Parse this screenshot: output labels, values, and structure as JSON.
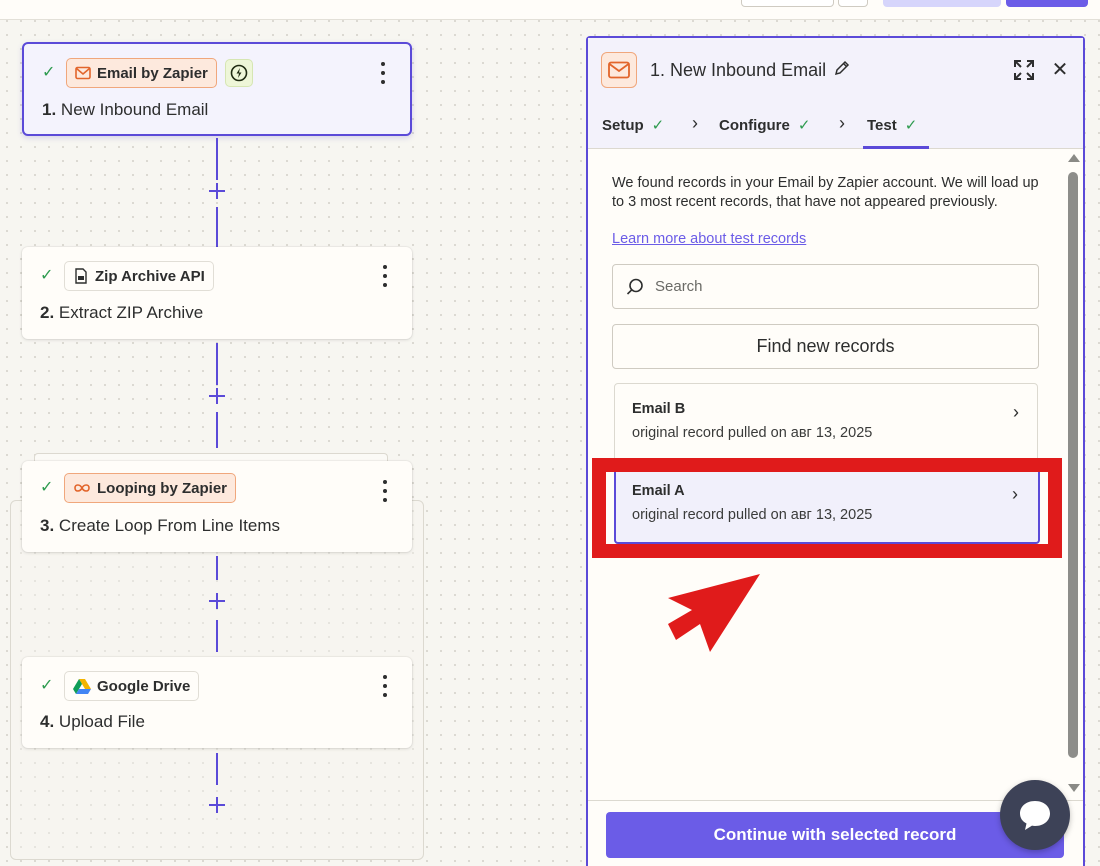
{
  "colors": {
    "accent": "#6b5ce7",
    "border_accent": "#5b4ad8",
    "success": "#2e9b4f",
    "annotation": "#e01b1b",
    "chat": "#3d4257"
  },
  "workflow": {
    "steps": [
      {
        "app": "Email by Zapier",
        "number": "1.",
        "title": "New Inbound Email",
        "icon": "email-icon",
        "status": "check-icon"
      },
      {
        "app": "Zip Archive API",
        "number": "2.",
        "title": "Extract ZIP Archive",
        "icon": "zip-archive-icon",
        "status": "check-icon"
      },
      {
        "app": "Looping by Zapier",
        "number": "3.",
        "title": "Create Loop From Line Items",
        "icon": "loop-icon",
        "status": "check-icon"
      },
      {
        "app": "Google Drive",
        "number": "4.",
        "title": "Upload File",
        "icon": "google-drive-icon",
        "status": "check-icon"
      }
    ]
  },
  "panel": {
    "title": "1. New Inbound Email",
    "tabs": [
      {
        "label": "Setup",
        "done": true
      },
      {
        "label": "Configure",
        "done": true
      },
      {
        "label": "Test",
        "done": true,
        "active": true
      }
    ],
    "intro": "We found records in your Email by Zapier account. We will load up to 3 most recent records, that have not appeared previously.",
    "learn_link": "Learn more about test records",
    "search_placeholder": "Search",
    "find_button": "Find new records",
    "records": [
      {
        "name": "Email B",
        "subtitle": "original record pulled on авг 13, 2025",
        "selected": false
      },
      {
        "name": "Email A",
        "subtitle": "original record pulled on авг 13, 2025",
        "selected": true
      }
    ],
    "continue_button": "Continue with selected record"
  }
}
